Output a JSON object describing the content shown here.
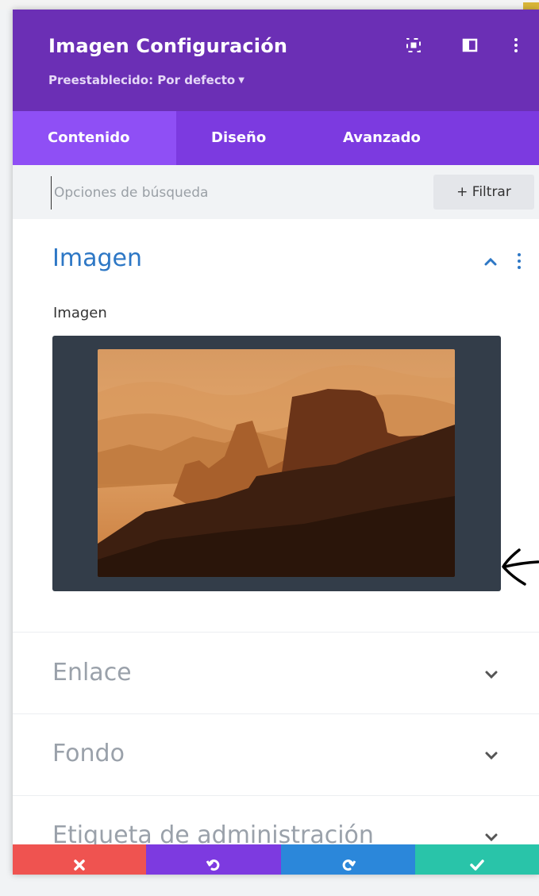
{
  "header": {
    "title": "Imagen Configuración",
    "preset": "Preestablecido: Por defecto",
    "bg_color": "#6b2fb5",
    "icons": [
      "fullscreen-icon",
      "split-view-icon",
      "more-vertical-icon"
    ]
  },
  "tabs": [
    {
      "label": "Contenido",
      "active": true
    },
    {
      "label": "Diseño",
      "active": false
    },
    {
      "label": "Avanzado",
      "active": false
    }
  ],
  "search": {
    "placeholder": "Opciones de búsqueda",
    "filter_label": "+ Filtrar"
  },
  "sections": [
    {
      "title": "Imagen",
      "expanded": true
    },
    {
      "title": "Enlace",
      "expanded": false
    },
    {
      "title": "Fondo",
      "expanded": false
    },
    {
      "title": "Etiqueta de administración",
      "expanded": false
    }
  ],
  "image_field": {
    "label": "Imagen",
    "preview": "desert-rock-landscape-at-sunset"
  },
  "footer": [
    {
      "action": "cancel",
      "icon": "close-icon",
      "color": "#ef5350"
    },
    {
      "action": "undo",
      "icon": "undo-icon",
      "color": "#7d3ae0"
    },
    {
      "action": "redo",
      "icon": "redo-icon",
      "color": "#2b87da"
    },
    {
      "action": "save",
      "icon": "check-icon",
      "color": "#29c4a9"
    }
  ],
  "colors": {
    "accent_blue": "#2d77c5",
    "tab_bar": "#7c3ae0",
    "active_tab": "#8f4ff5"
  }
}
